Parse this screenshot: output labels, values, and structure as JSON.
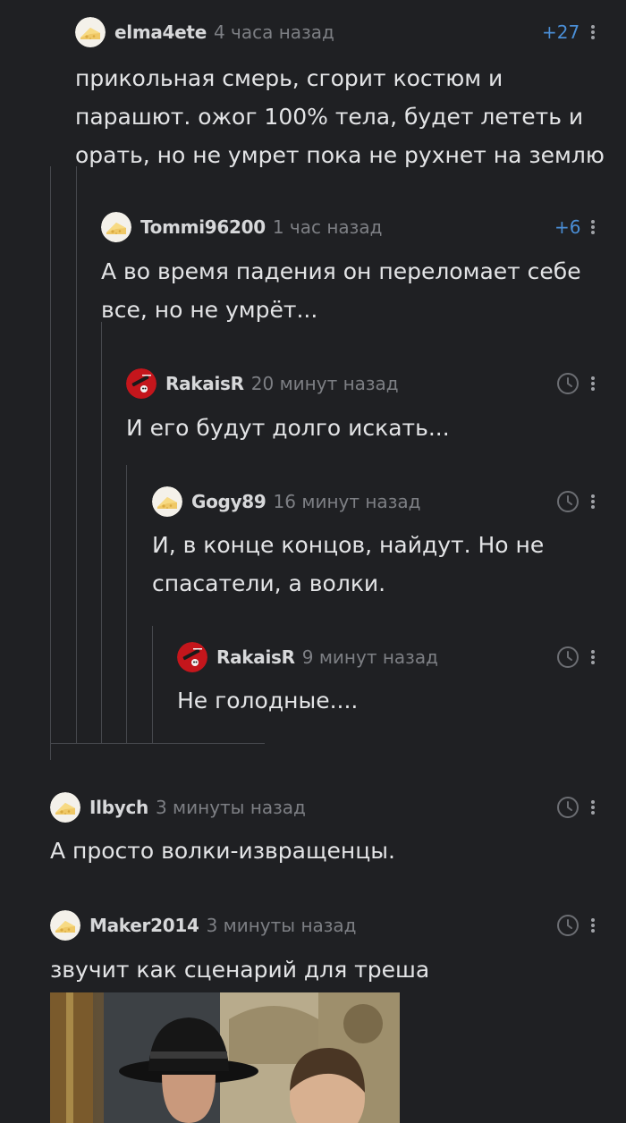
{
  "comments": [
    {
      "id": "c1",
      "username": "elma4ete",
      "time": "4 часа назад",
      "rating": "+27",
      "lines": [
        "прикольная смерь, сгорит костюм и",
        "парашют. ожог 100% тела, будет лететь и",
        "орать, но не умрет пока не рухнет на землю"
      ],
      "avatar": "cheese-avatar"
    },
    {
      "id": "c2",
      "username": "Tommi96200",
      "time": "1 час назад",
      "rating": "+6",
      "lines": [
        "А во время падения он переломает себе",
        "все, но не умрёт..."
      ],
      "avatar": "cheese-avatar"
    },
    {
      "id": "c3",
      "username": "RakaisR",
      "time": "20 минут назад",
      "lines": [
        "И его будут долго искать..."
      ],
      "avatar": "red-avatar"
    },
    {
      "id": "c4",
      "username": "Gogy89",
      "time": "16 минут назад",
      "lines": [
        "И, в конце концов, найдут. Но не",
        "спасатели, а волки."
      ],
      "avatar": "cheese-avatar"
    },
    {
      "id": "c5",
      "username": "RakaisR",
      "time": "9 минут назад",
      "lines": [
        "Не голодные...."
      ],
      "avatar": "red-avatar"
    },
    {
      "id": "c6",
      "username": "Ilbych",
      "time": "3 минуты назад",
      "lines": [
        "А просто волки-извращенцы."
      ],
      "avatar": "cheese-avatar"
    },
    {
      "id": "c7",
      "username": "Maker2014",
      "time": "3 минуты назад",
      "lines": [
        "звучит как сценарий для треша"
      ],
      "avatar": "cheese-avatar",
      "has_image": true
    }
  ],
  "icons": {
    "more": "more-vertical-icon",
    "clock": "clock-icon"
  },
  "colors": {
    "background": "#1f2023",
    "text": "#e3e4e6",
    "username": "#d7d8da",
    "meta": "#7d7f84",
    "rating": "#4a8ed6",
    "thread_line": "#46484d"
  }
}
